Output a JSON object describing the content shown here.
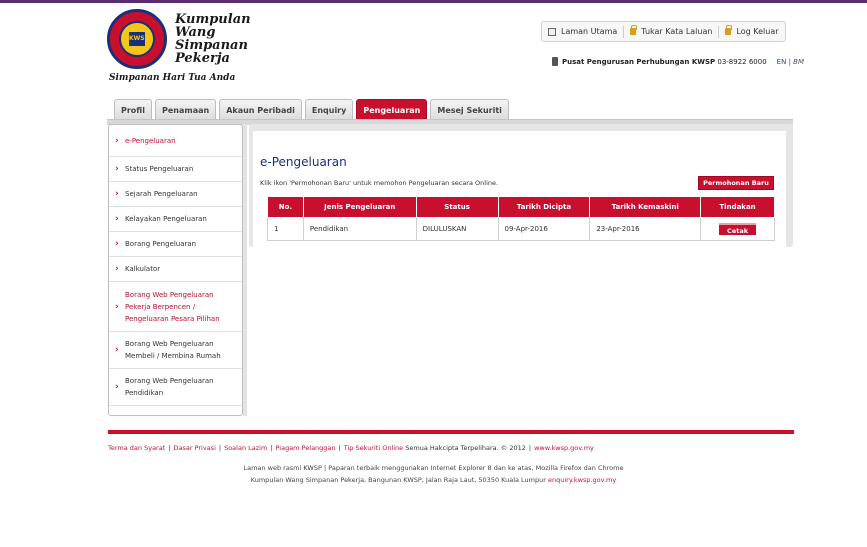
{
  "header": {
    "logo_name": [
      "Kumpulan",
      "Wang",
      "Simpanan",
      "Pekerja"
    ],
    "logo_emblem_text": "KWSP",
    "tagline": "Simpanan Hari Tua Anda",
    "links": [
      {
        "label": "Laman Utama",
        "icon": "home-icon"
      },
      {
        "label": "Tukar Kata Laluan",
        "icon": "lock-icon"
      },
      {
        "label": "Log Keluar",
        "icon": "lock-icon"
      }
    ],
    "contact_label": "Pusat Pengurusan Perhubungan KWSP",
    "contact_phone": "03-8922 6000",
    "lang_en": "EN",
    "lang_sep": "|",
    "lang_bm": "BM"
  },
  "tabs": [
    "Profil",
    "Penamaan",
    "Akaun Peribadi",
    "Enquiry",
    "Pengeluaran",
    "Mesej Sekuriti"
  ],
  "active_tab": "Pengeluaran",
  "sidebar": {
    "items": [
      "e-Pengeluaran",
      "Status Pengeluaran",
      "Sejarah Pengeluaran",
      "Kelayakan Pengeluaran",
      "Borang Pengeluaran",
      "Kalkulator",
      "Borang Web Pengeluaran Pekerja Berpencen / Pengeluaran Pesara Pilihan",
      "Borang Web Pengeluaran Membeli / Membina Rumah",
      "Borang Web Pengeluaran Pendidikan"
    ]
  },
  "main": {
    "title": "e-Pengeluaran",
    "instruction": "Klik ikon 'Permohonan Baru' untuk memohon Pengeluaran secara Online.",
    "new_button": "Permohonan Baru",
    "table": {
      "headers": [
        "No.",
        "Jenis Pengeluaran",
        "Status",
        "Tarikh Dicipta",
        "Tarikh Kemaskini",
        "Tindakan"
      ],
      "rows": [
        {
          "no": "1",
          "jenis": "Pendidikan",
          "status": "DILULUSKAN",
          "dicipta": "09-Apr-2016",
          "kemaskini": "23-Apr-2016",
          "action": "Cetak"
        }
      ]
    }
  },
  "footer": {
    "links": [
      "Terma dan Syarat",
      "Dasar Privasi",
      "Soalan Lazim",
      "Piagam Pelanggan",
      "Tip Sekuriti Online"
    ],
    "copyright": "Semua Hakcipta Terpelihara. © 2012",
    "site": "www.kwsp.gov.my",
    "line2": "Laman web rasmi KWSP | Paparan terbaik menggunakan Internet Explorer 8 dan ke atas, Mozilla Firefox dan Chrome",
    "line3": "Kumpulan Wang Simpanan Pekerja, Bangunan KWSP, Jalan Raja Laut, 50350 Kuala Lumpur",
    "email": "enquiry.kwsp.gov.my"
  },
  "colors": {
    "primary_red": "#c8102e",
    "navy": "#1a2f7a"
  }
}
